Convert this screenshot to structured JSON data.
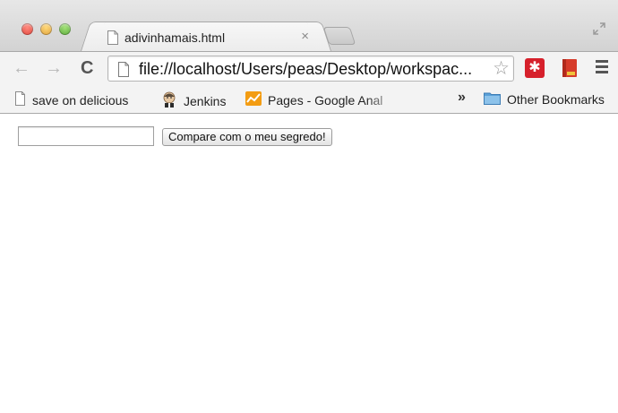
{
  "window": {
    "traffic_lights": [
      "close",
      "minimize",
      "zoom"
    ],
    "colors": {
      "close": "#e0443a",
      "minimize": "#dea03a",
      "zoom": "#58a838"
    }
  },
  "tab": {
    "title": "adivinhamais.html",
    "close_glyph": "×"
  },
  "toolbar": {
    "back_glyph": "←",
    "forward_glyph": "→",
    "reload_glyph": "C",
    "url": "file://localhost/Users/peas/Desktop/workspac...",
    "star_glyph": "☆",
    "extension_glyph": "✱",
    "extension_color": "#d6202b"
  },
  "bookmarks": {
    "items": [
      {
        "label": "save on delicious",
        "icon": "page-icon"
      },
      {
        "label": "Jenkins",
        "icon": "jenkins-icon"
      },
      {
        "label": "Pages - Google Anal",
        "icon": "analytics-icon"
      }
    ],
    "overflow_glyph": "»",
    "other": {
      "label": "Other Bookmarks",
      "icon": "folder-icon"
    }
  },
  "page": {
    "input_value": "",
    "button_label": "Compare com o meu segredo!"
  }
}
